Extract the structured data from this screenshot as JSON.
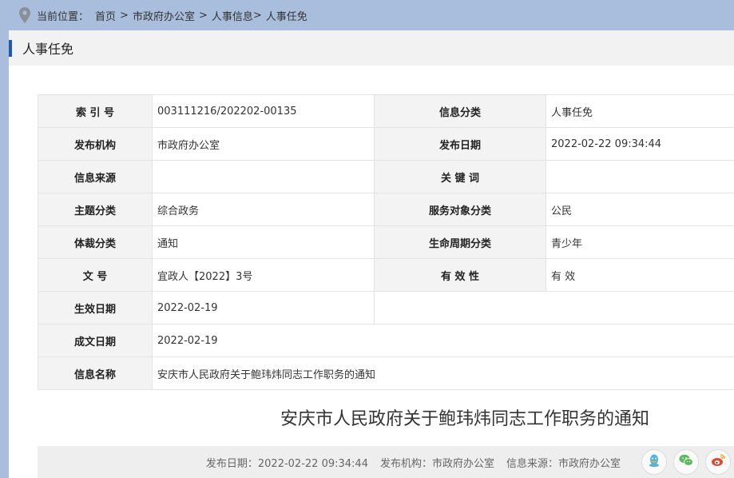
{
  "breadcrumb": {
    "prefix": "当前位置：",
    "items": [
      "首页",
      "市政府办公室",
      "人事信息",
      "人事任免"
    ],
    "separator": ">"
  },
  "section": {
    "title": "人事任免"
  },
  "info": {
    "rows": [
      {
        "l1": "索 引 号",
        "v1": "003111216/202202-00135",
        "l2": "信息分类",
        "v2": "人事任免"
      },
      {
        "l1": "发布机构",
        "v1": "市政府办公室",
        "l2": "发布日期",
        "v2": "2022-02-22 09:34:44"
      },
      {
        "l1": "信息来源",
        "v1": "",
        "l2": "关 键 词",
        "v2": ""
      },
      {
        "l1": "主题分类",
        "v1": "综合政务",
        "l2": "服务对象分类",
        "v2": "公民"
      },
      {
        "l1": "体裁分类",
        "v1": "通知",
        "l2": "生命周期分类",
        "v2": "青少年"
      },
      {
        "l1": "文 号",
        "v1": "宜政人【2022】3号",
        "l2": "有 效 性",
        "v2": "有 效"
      },
      {
        "l1": "生效日期",
        "v1": "2022-02-19"
      },
      {
        "l1": "成文日期",
        "v1": "2022-02-19"
      },
      {
        "l1": "信息名称",
        "v1": "安庆市人民政府关于鲍玮炜同志工作职务的通知"
      }
    ]
  },
  "document": {
    "title": "安庆市人民政府关于鲍玮炜同志工作职务的通知",
    "meta": {
      "date": "发布日期：2022-02-22 09:34:44",
      "org": "发布机构：市政府办公室",
      "source": "信息来源：市政府办公室"
    }
  },
  "share": {
    "icons": [
      "qq-icon",
      "wechat-icon",
      "weibo-icon"
    ],
    "colors": {
      "qq": "#4fb3e8",
      "wechat": "#5cb85c",
      "weibo": "#e6462d"
    }
  },
  "colors": {
    "background": "#a9bedd",
    "accent": "#1c5ab4",
    "label_bg": "#f3f3f3"
  }
}
